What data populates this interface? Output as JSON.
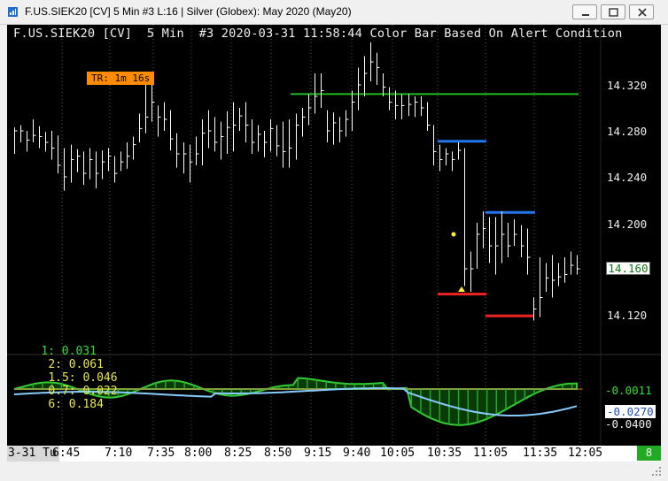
{
  "window": {
    "title": "F.US.SIEK20 [CV]  5 Min  #3  L:16 | Silver (Globex): May 2020 (May20)"
  },
  "chart": {
    "header": "F.US.SIEK20 [CV]  5 Min  #3 2020-03-31 11:58:44 Color Bar Based On Alert Condition",
    "timer_badge": "TR: 1m 16s",
    "last_price": "14.160",
    "price_labels": [
      "14.320",
      "14.280",
      "14.240",
      "14.200",
      "14.120"
    ],
    "status_values": [
      {
        "text": "1: 0.031",
        "color": "#33dd33"
      },
      {
        "text": "2: 0.061",
        "color": "#e8e84a"
      },
      {
        "text": "1.5: 0.046",
        "color": "#e8e84a"
      },
      {
        "text": "0.7: 0.022",
        "color": "#e8e84a"
      },
      {
        "text": "6: 0.184",
        "color": "#e8e84a"
      }
    ],
    "indicator_labels": [
      "-0.0011",
      "-0.0270",
      "-0.0400"
    ],
    "time_axis": {
      "date": "3-31 Tu",
      "ticks": [
        "6:45",
        "7:10",
        "7:35",
        "8:00",
        "8:25",
        "8:50",
        "9:15",
        "9:40",
        "10:05",
        "10:35",
        "11:05",
        "11:35",
        "12:05"
      ]
    },
    "bar_count": "8",
    "colors": {
      "background": "#000000",
      "bars": "#ffffff",
      "green_level": "#22bb22",
      "blue_level": "#2277ee",
      "red_level": "#ee2222",
      "histogram": "#22aa22",
      "oscillator_line": "#88ccff",
      "timer_badge": "#ff8c00"
    }
  },
  "chart_data": {
    "type": "ohlc",
    "ylim": [
      14.1,
      14.37
    ],
    "levels": [
      {
        "name": "green",
        "price": 14.312
      },
      {
        "name": "blue_1",
        "price": 14.271
      },
      {
        "name": "blue_2",
        "price": 14.209
      },
      {
        "name": "red_1",
        "price": 14.138
      },
      {
        "name": "red_2",
        "price": 14.119
      }
    ],
    "bars": [
      [
        14.283,
        14.26,
        14.28
      ],
      [
        14.285,
        14.27,
        14.28
      ],
      [
        14.28,
        14.262,
        14.272
      ],
      [
        14.29,
        14.27,
        14.276
      ],
      [
        14.284,
        14.265,
        14.275
      ],
      [
        14.279,
        14.262,
        14.27
      ],
      [
        14.28,
        14.255,
        14.265
      ],
      [
        14.276,
        14.243,
        14.25
      ],
      [
        14.265,
        14.228,
        14.24
      ],
      [
        14.268,
        14.235,
        14.255
      ],
      [
        14.264,
        14.244,
        14.258
      ],
      [
        14.262,
        14.233,
        14.243
      ],
      [
        14.265,
        14.238,
        14.255
      ],
      [
        14.262,
        14.23,
        14.243
      ],
      [
        14.263,
        14.238,
        14.253
      ],
      [
        14.265,
        14.245,
        14.258
      ],
      [
        14.258,
        14.235,
        14.243
      ],
      [
        14.262,
        14.245,
        14.253
      ],
      [
        14.27,
        14.247,
        14.258
      ],
      [
        14.275,
        14.255,
        14.268
      ],
      [
        14.295,
        14.27,
        14.282
      ],
      [
        14.32,
        14.278,
        14.292
      ],
      [
        14.33,
        14.288,
        14.305
      ],
      [
        14.302,
        14.275,
        14.292
      ],
      [
        14.305,
        14.28,
        14.29
      ],
      [
        14.298,
        14.263,
        14.273
      ],
      [
        14.278,
        14.248,
        14.26
      ],
      [
        14.27,
        14.243,
        14.26
      ],
      [
        14.268,
        14.235,
        14.253
      ],
      [
        14.275,
        14.25,
        14.26
      ],
      [
        14.29,
        14.25,
        14.278
      ],
      [
        14.298,
        14.265,
        14.28
      ],
      [
        14.292,
        14.262,
        14.27
      ],
      [
        14.288,
        14.255,
        14.275
      ],
      [
        14.297,
        14.26,
        14.283
      ],
      [
        14.305,
        14.262,
        14.285
      ],
      [
        14.3,
        14.28,
        14.293
      ],
      [
        14.305,
        14.27,
        14.285
      ],
      [
        14.29,
        14.26,
        14.27
      ],
      [
        14.285,
        14.262,
        14.277
      ],
      [
        14.28,
        14.257,
        14.27
      ],
      [
        14.29,
        14.262,
        14.282
      ],
      [
        14.285,
        14.258,
        14.267
      ],
      [
        14.288,
        14.248,
        14.262
      ],
      [
        14.29,
        14.248,
        14.265
      ],
      [
        14.295,
        14.255,
        14.285
      ],
      [
        14.3,
        14.275,
        14.292
      ],
      [
        14.312,
        14.285,
        14.3
      ],
      [
        14.33,
        14.295,
        14.31
      ],
      [
        14.33,
        14.3,
        14.315
      ],
      [
        14.298,
        14.27,
        14.28
      ],
      [
        14.296,
        14.268,
        14.287
      ],
      [
        14.292,
        14.27,
        14.28
      ],
      [
        14.298,
        14.275,
        14.29
      ],
      [
        14.315,
        14.28,
        14.305
      ],
      [
        14.335,
        14.298,
        14.32
      ],
      [
        14.345,
        14.31,
        14.33
      ],
      [
        14.357,
        14.323,
        14.34
      ],
      [
        14.348,
        14.32,
        14.335
      ],
      [
        14.33,
        14.31,
        14.318
      ],
      [
        14.318,
        14.298,
        14.305
      ],
      [
        14.315,
        14.29,
        14.302
      ],
      [
        14.312,
        14.29,
        14.302
      ],
      [
        14.312,
        14.293,
        14.303
      ],
      [
        14.31,
        14.292,
        14.305
      ],
      [
        14.31,
        14.293,
        14.3
      ],
      [
        14.305,
        14.28,
        14.285
      ],
      [
        14.285,
        14.25,
        14.262
      ],
      [
        14.268,
        14.245,
        14.255
      ],
      [
        14.265,
        14.25,
        14.26
      ],
      [
        14.262,
        14.245,
        14.255
      ],
      [
        14.27,
        14.255,
        14.263
      ],
      [
        14.265,
        14.145,
        14.16
      ],
      [
        14.175,
        14.14,
        14.16
      ],
      [
        14.2,
        14.16,
        14.19
      ],
      [
        14.21,
        14.178,
        14.195
      ],
      [
        14.205,
        14.165,
        14.18
      ],
      [
        14.205,
        14.155,
        14.18
      ],
      [
        14.21,
        14.165,
        14.19
      ],
      [
        14.2,
        14.17,
        14.18
      ],
      [
        14.203,
        14.18,
        14.19
      ],
      [
        14.198,
        14.17,
        14.18
      ],
      [
        14.195,
        14.155,
        14.17
      ],
      [
        14.135,
        14.115,
        14.125
      ],
      [
        14.17,
        14.118,
        14.135
      ],
      [
        14.165,
        14.14,
        14.152
      ],
      [
        14.172,
        14.135,
        14.15
      ],
      [
        14.165,
        14.145,
        14.153
      ],
      [
        14.17,
        14.148,
        14.155
      ],
      [
        14.175,
        14.155,
        14.163
      ],
      [
        14.172,
        14.155,
        14.16
      ]
    ]
  }
}
